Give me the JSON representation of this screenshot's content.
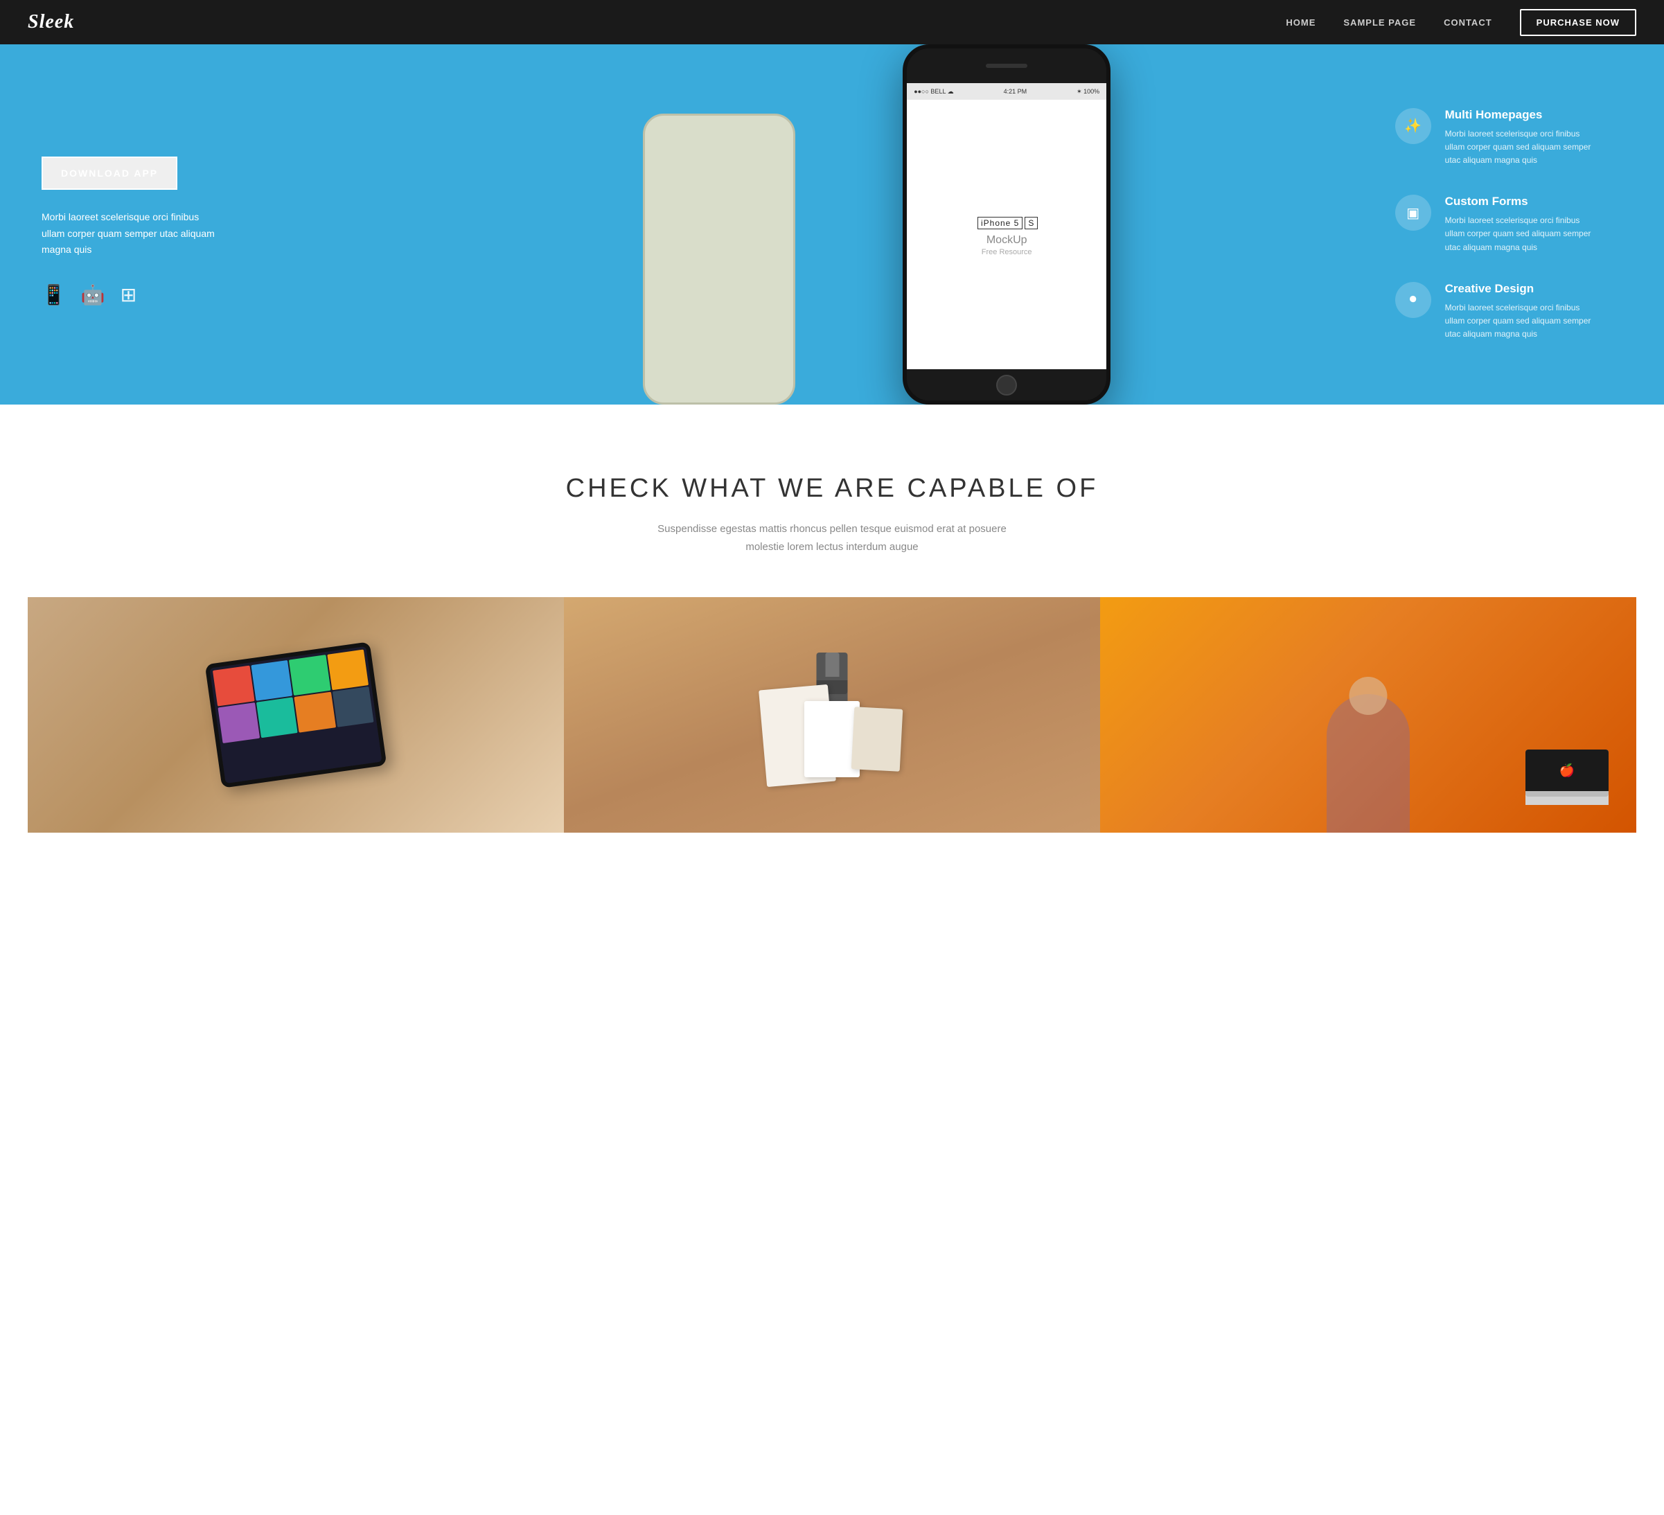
{
  "nav": {
    "logo": "Sleek",
    "links": [
      {
        "label": "HOME",
        "href": "#"
      },
      {
        "label": "SAMPLE PAGE",
        "href": "#"
      },
      {
        "label": "CONTACT",
        "href": "#"
      }
    ],
    "purchase_label": "PURCHASE NOW",
    "purchase_href": "#"
  },
  "hero": {
    "download_btn": "DOWNLOAD APP",
    "description": "Morbi laoreet scelerisque orci finibus ullam corper quam semper utac aliquam magna quis",
    "icons": [
      "mobile-icon",
      "android-icon",
      "windows-icon"
    ],
    "phone": {
      "status_left": "●●○○ BELL ☁",
      "status_time": "4:21 PM",
      "status_right": "✶ 100%",
      "iphone_label": "iPhone 5",
      "iphone_suffix": "S",
      "mockup_text": "MockUp",
      "free_text": "Free Resource"
    }
  },
  "features": [
    {
      "icon": "magic-icon",
      "title": "Multi Homepages",
      "description": "Morbi laoreet scelerisque orci finibus ullam corper quam sed aliquam semper utac aliquam magna quis"
    },
    {
      "icon": "tablet-icon",
      "title": "Custom Forms",
      "description": "Morbi laoreet scelerisque orci finibus ullam corper quam sed aliquam semper utac aliquam magna quis"
    },
    {
      "icon": "toggle-icon",
      "title": "Creative Design",
      "description": "Morbi laoreet scelerisque orci finibus ullam corper quam sed aliquam semper utac aliquam magna quis"
    }
  ],
  "capable_section": {
    "heading": "CHECK WHAT WE ARE CAPABLE OF",
    "subtext": "Suspendisse egestas mattis rhoncus pellen tesque euismod erat at\nposuere molestie lorem lectus interdum augue"
  },
  "colors": {
    "hero_bg": "#3aabdb",
    "nav_bg": "#1a1a1a",
    "purchase_btn_border": "#ffffff",
    "accent": "#3aabdb"
  }
}
